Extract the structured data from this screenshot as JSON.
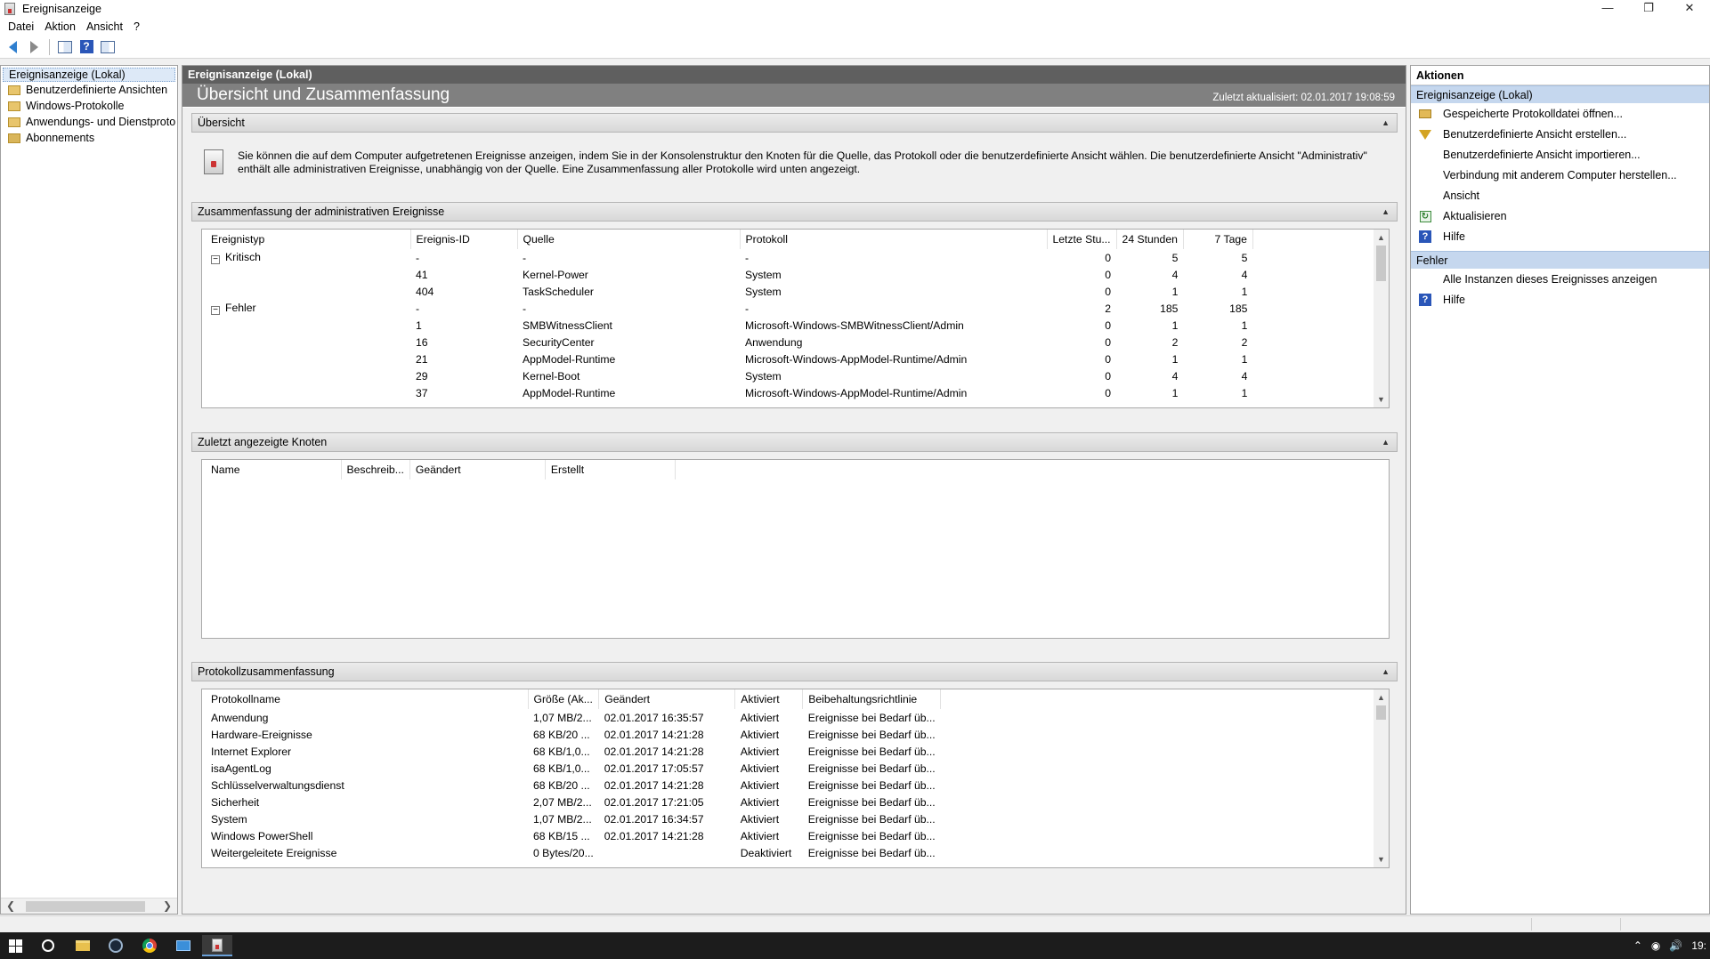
{
  "window": {
    "title": "Ereignisanzeige",
    "minimize_glyph": "—",
    "restore_glyph": "❐",
    "close_glyph": "✕"
  },
  "menu": [
    "Datei",
    "Aktion",
    "Ansicht",
    "?"
  ],
  "toolbar": {
    "icons": [
      "back-arrow-icon",
      "forward-arrow-icon",
      "show-hide-tree-icon",
      "help-icon",
      "show-hide-action-pane-icon"
    ],
    "help_glyph": "?"
  },
  "tree": {
    "root": "Ereignisanzeige (Lokal)",
    "items": [
      "Benutzerdefinierte Ansichten",
      "Windows-Protokolle",
      "Anwendungs- und Dienstproto",
      "Abonnements"
    ]
  },
  "center": {
    "header": "Ereignisanzeige (Lokal)",
    "banner_title": "Übersicht und Zusammenfassung",
    "last_updated": "Zuletzt aktualisiert: 02.01.2017 19:08:59",
    "overview": {
      "title": "Übersicht",
      "text": "Sie können die auf dem Computer aufgetretenen Ereignisse anzeigen, indem Sie in der Konsolenstruktur den Knoten für die Quelle, das Protokoll oder die benutzerdefinierte Ansicht wählen. Die benutzerdefinierte Ansicht \"Administrativ\" enthält alle administrativen Ereignisse, unabhängig von der Quelle. Eine Zusammenfassung aller Protokolle wird unten angezeigt."
    },
    "admin_summary": {
      "title": "Zusammenfassung der administrativen Ereignisse",
      "columns": [
        "Ereignistyp",
        "Ereignis-ID",
        "Quelle",
        "Protokoll",
        "Letzte Stu...",
        "24 Stunden",
        "7 Tage"
      ],
      "rows": [
        {
          "type": "Kritisch",
          "expander": "−",
          "id": "-",
          "source": "-",
          "log": "-",
          "hour": "0",
          "day": "5",
          "week": "5"
        },
        {
          "type": "",
          "expander": "",
          "id": "41",
          "source": "Kernel-Power",
          "log": "System",
          "hour": "0",
          "day": "4",
          "week": "4"
        },
        {
          "type": "",
          "expander": "",
          "id": "404",
          "source": "TaskScheduler",
          "log": "System",
          "hour": "0",
          "day": "1",
          "week": "1"
        },
        {
          "type": "Fehler",
          "expander": "−",
          "id": "-",
          "source": "-",
          "log": "-",
          "hour": "2",
          "day": "185",
          "week": "185"
        },
        {
          "type": "",
          "expander": "",
          "id": "1",
          "source": "SMBWitnessClient",
          "log": "Microsoft-Windows-SMBWitnessClient/Admin",
          "hour": "0",
          "day": "1",
          "week": "1"
        },
        {
          "type": "",
          "expander": "",
          "id": "16",
          "source": "SecurityCenter",
          "log": "Anwendung",
          "hour": "0",
          "day": "2",
          "week": "2"
        },
        {
          "type": "",
          "expander": "",
          "id": "21",
          "source": "AppModel-Runtime",
          "log": "Microsoft-Windows-AppModel-Runtime/Admin",
          "hour": "0",
          "day": "1",
          "week": "1"
        },
        {
          "type": "",
          "expander": "",
          "id": "29",
          "source": "Kernel-Boot",
          "log": "System",
          "hour": "0",
          "day": "4",
          "week": "4"
        },
        {
          "type": "",
          "expander": "",
          "id": "37",
          "source": "AppModel-Runtime",
          "log": "Microsoft-Windows-AppModel-Runtime/Admin",
          "hour": "0",
          "day": "1",
          "week": "1"
        }
      ]
    },
    "recent_nodes": {
      "title": "Zuletzt angezeigte Knoten",
      "columns": [
        "Name",
        "Beschreib...",
        "Geändert",
        "Erstellt"
      ]
    },
    "log_summary": {
      "title": "Protokollzusammenfassung",
      "columns": [
        "Protokollname",
        "Größe (Ak...",
        "Geändert",
        "Aktiviert",
        "Beibehaltungsrichtlinie"
      ],
      "rows": [
        {
          "name": "Anwendung",
          "size": "1,07 MB/2...",
          "changed": "02.01.2017 16:35:57",
          "enabled": "Aktiviert",
          "policy": "Ereignisse bei Bedarf üb..."
        },
        {
          "name": "Hardware-Ereignisse",
          "size": "68 KB/20 ...",
          "changed": "02.01.2017 14:21:28",
          "enabled": "Aktiviert",
          "policy": "Ereignisse bei Bedarf üb..."
        },
        {
          "name": "Internet Explorer",
          "size": "68 KB/1,0...",
          "changed": "02.01.2017 14:21:28",
          "enabled": "Aktiviert",
          "policy": "Ereignisse bei Bedarf üb..."
        },
        {
          "name": "isaAgentLog",
          "size": "68 KB/1,0...",
          "changed": "02.01.2017 17:05:57",
          "enabled": "Aktiviert",
          "policy": "Ereignisse bei Bedarf üb..."
        },
        {
          "name": "Schlüsselverwaltungsdienst",
          "size": "68 KB/20 ...",
          "changed": "02.01.2017 14:21:28",
          "enabled": "Aktiviert",
          "policy": "Ereignisse bei Bedarf üb..."
        },
        {
          "name": "Sicherheit",
          "size": "2,07 MB/2...",
          "changed": "02.01.2017 17:21:05",
          "enabled": "Aktiviert",
          "policy": "Ereignisse bei Bedarf üb..."
        },
        {
          "name": "System",
          "size": "1,07 MB/2...",
          "changed": "02.01.2017 16:34:57",
          "enabled": "Aktiviert",
          "policy": "Ereignisse bei Bedarf üb..."
        },
        {
          "name": "Windows PowerShell",
          "size": "68 KB/15 ...",
          "changed": "02.01.2017 14:21:28",
          "enabled": "Aktiviert",
          "policy": "Ereignisse bei Bedarf üb..."
        },
        {
          "name": "Weitergeleitete Ereignisse",
          "size": "0 Bytes/20...",
          "changed": "",
          "enabled": "Deaktiviert",
          "policy": "Ereignisse bei Bedarf üb..."
        }
      ]
    }
  },
  "actions": {
    "title": "Aktionen",
    "group1": {
      "label": "Ereignisanzeige (Lokal)",
      "items": [
        {
          "label": "Gespeicherte Protokolldatei öffnen...",
          "icon": "open-folder-icon"
        },
        {
          "label": "Benutzerdefinierte Ansicht erstellen...",
          "icon": "filter-icon"
        },
        {
          "label": "Benutzerdefinierte Ansicht importieren...",
          "icon": ""
        },
        {
          "label": "Verbindung mit anderem Computer herstellen...",
          "icon": ""
        },
        {
          "label": "Ansicht",
          "icon": ""
        },
        {
          "label": "Aktualisieren",
          "icon": "refresh-icon"
        },
        {
          "label": "Hilfe",
          "icon": "help-icon"
        }
      ]
    },
    "group2": {
      "label": "Fehler",
      "items": [
        {
          "label": "Alle Instanzen dieses Ereignisses anzeigen",
          "icon": ""
        },
        {
          "label": "Hilfe",
          "icon": "help-icon"
        }
      ]
    }
  },
  "taskbar": {
    "apps": [
      "start-icon",
      "cortana-icon",
      "file-explorer-icon",
      "steam-icon",
      "chrome-icon",
      "vm-icon",
      "event-viewer-icon"
    ],
    "clock": "19:"
  },
  "colors": {
    "header_dark": "#5f5f5f",
    "banner_gray": "#808080",
    "action_group_blue": "#c5d7ee",
    "taskbar": "#1c1c1c"
  }
}
